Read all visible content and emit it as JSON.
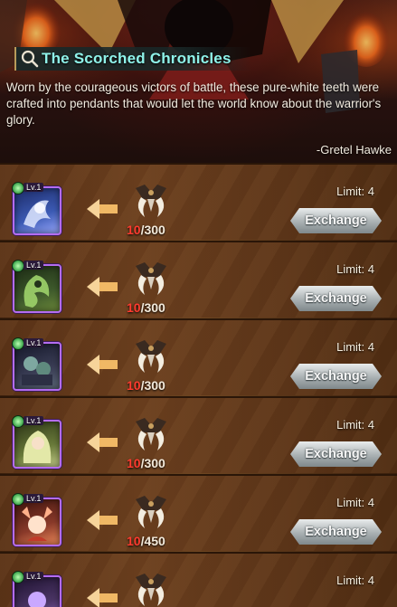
{
  "header": {
    "title": "The Scorched Chronicles",
    "lore": "Worn by the courageous victors of battle, these pure-white teeth were crafted into pendants that would let the world know about the warrior's glory.",
    "author": "-Gretel Hawke",
    "icon": "magnifier-icon"
  },
  "rows": [
    {
      "level": "Lv.1",
      "have": "10",
      "need": "/300",
      "limit": "Limit: 4",
      "button": "Exchange",
      "hero_color": "#3c5bb5",
      "accent": "#dfe7ff"
    },
    {
      "level": "Lv.1",
      "have": "10",
      "need": "/300",
      "limit": "Limit: 4",
      "button": "Exchange",
      "hero_color": "#3e5a2c",
      "accent": "#9fd36a"
    },
    {
      "level": "Lv.1",
      "have": "10",
      "need": "/300",
      "limit": "Limit: 4",
      "button": "Exchange",
      "hero_color": "#3a3d55",
      "accent": "#7ea8a0"
    },
    {
      "level": "Lv.1",
      "have": "10",
      "need": "/300",
      "limit": "Limit: 4",
      "button": "Exchange",
      "hero_color": "#6a7b3a",
      "accent": "#e3e8a8"
    },
    {
      "level": "Lv.1",
      "have": "10",
      "need": "/450",
      "limit": "Limit: 4",
      "button": "Exchange",
      "hero_color": "#8a3a2a",
      "accent": "#ffb08a"
    },
    {
      "level": "Lv.1",
      "have": "",
      "need": "",
      "limit": "Limit: 4",
      "button": "",
      "hero_color": "#4b3565",
      "accent": "#c9a8ff"
    }
  ]
}
